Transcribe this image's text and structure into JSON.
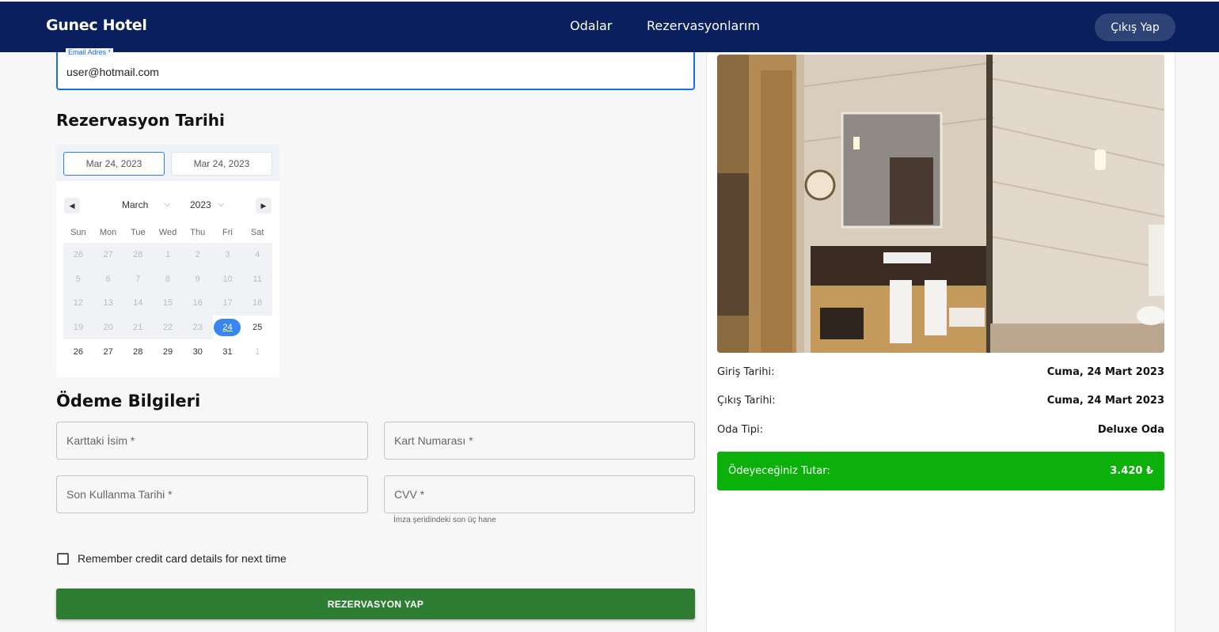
{
  "header": {
    "brand": "Gunec Hotel",
    "nav": [
      "Odalar",
      "Rezervasyonlarım"
    ],
    "logout_label": "Çıkış Yap",
    "bg_color": "#0a1f5e"
  },
  "email": {
    "label": "Email Adres *",
    "value": "user@hotmail.com"
  },
  "reservation": {
    "title": "Rezervasyon Tarihi",
    "start_date": "Mar 24, 2023",
    "end_date": "Mar 24, 2023",
    "month": "March",
    "year": "2023",
    "weekdays": [
      "Sun",
      "Mon",
      "Tue",
      "Wed",
      "Thu",
      "Fri",
      "Sat"
    ],
    "weeks": [
      [
        "26",
        "27",
        "28",
        "1",
        "2",
        "3",
        "4"
      ],
      [
        "5",
        "6",
        "7",
        "8",
        "9",
        "10",
        "11"
      ],
      [
        "12",
        "13",
        "14",
        "15",
        "16",
        "17",
        "18"
      ],
      [
        "19",
        "20",
        "21",
        "22",
        "23",
        "24",
        "25"
      ],
      [
        "26",
        "27",
        "28",
        "29",
        "30",
        "31",
        "1"
      ]
    ],
    "selected_day": "24"
  },
  "payment": {
    "title": "Ödeme Bilgileri",
    "card_name_placeholder": "Karttaki İsim *",
    "card_number_placeholder": "Kart Numarası *",
    "expiry_placeholder": "Son Kullanma Tarihi *",
    "cvv_placeholder": "CVV *",
    "cvv_help": "İmza şeridindeki son üç hane",
    "remember_label": "Remember credit card details for next time",
    "submit_label": "REZERVASYON YAP"
  },
  "summary": {
    "checkin_label": "Giriş Tarihi:",
    "checkin_value": "Cuma, 24 Mart 2023",
    "checkout_label": "Çıkış Tarihi:",
    "checkout_value": "Cuma, 24 Mart 2023",
    "room_label": "Oda Tipi:",
    "room_value": "Deluxe Oda",
    "total_label": "Ödeyeceğiniz Tutar:",
    "total_value": "3.420 ₺",
    "total_color": "#0bb00b"
  }
}
